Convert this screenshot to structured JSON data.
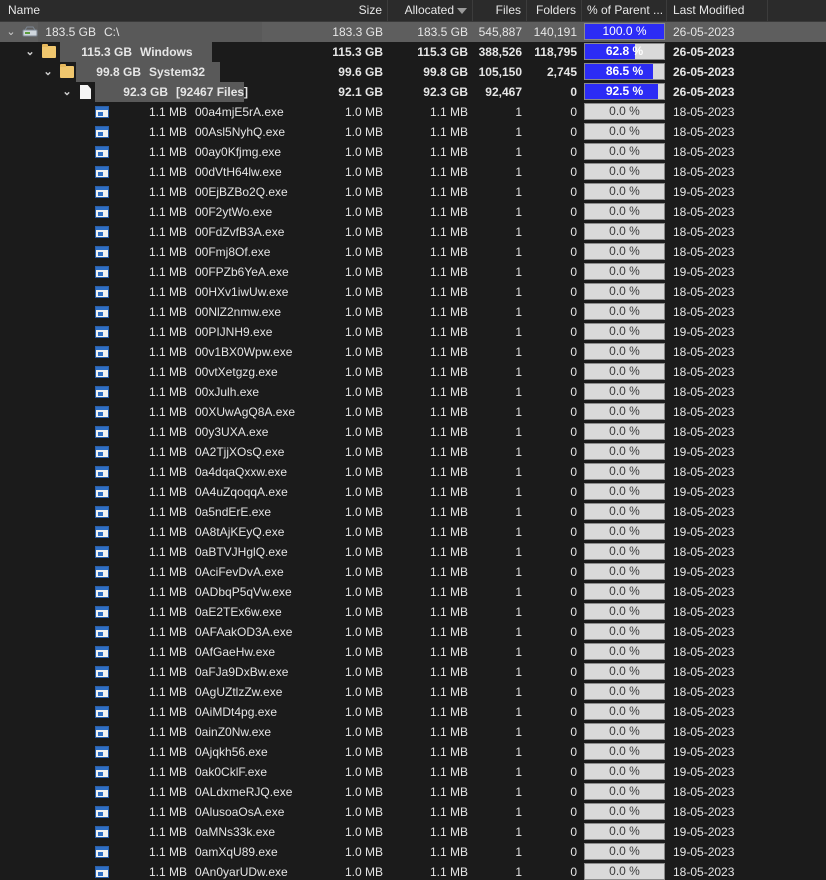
{
  "columns": {
    "name": "Name",
    "size": "Size",
    "allocated": "Allocated",
    "files": "Files",
    "folders": "Folders",
    "pct_parent": "% of Parent ...",
    "last_modified": "Last Modified"
  },
  "colors": {
    "background": "#1b1b1b",
    "header": "#2b2b2b",
    "selected_row": "#5e5e5e",
    "bar_fill": "#2c2cf5",
    "bar_track": "#d9d9d9",
    "folder": "#f0c76e",
    "exe_icon": "#2f6fc4"
  },
  "tree": [
    {
      "level": 0,
      "icon": "drive-icon",
      "expanded": true,
      "selected": true,
      "bold": false,
      "label_size": "183.5 GB",
      "label_name": "C:\\",
      "size": "183.3 GB",
      "allocated": "183.5 GB",
      "files": "545,887",
      "folders": "140,191",
      "pct": "100.0 %",
      "pct_value": 100.0,
      "modified": "26-05-2023"
    },
    {
      "level": 1,
      "icon": "folder-icon",
      "expanded": true,
      "selected": false,
      "bold": true,
      "label_size": "115.3 GB",
      "label_name": "Windows",
      "size": "115.3 GB",
      "allocated": "115.3 GB",
      "files": "388,526",
      "folders": "118,795",
      "pct": "62.8 %",
      "pct_value": 62.8,
      "modified": "26-05-2023"
    },
    {
      "level": 2,
      "icon": "folder-icon",
      "expanded": true,
      "selected": false,
      "bold": true,
      "label_size": "99.8 GB",
      "label_name": "System32",
      "size": "99.6 GB",
      "allocated": "99.8 GB",
      "files": "105,150",
      "folders": "2,745",
      "pct": "86.5 %",
      "pct_value": 86.5,
      "modified": "26-05-2023"
    },
    {
      "level": 3,
      "icon": "file-icon",
      "expanded": true,
      "selected": false,
      "bold": true,
      "label_size": "92.3 GB",
      "label_name": "[92467 Files]",
      "size": "92.1 GB",
      "allocated": "92.3 GB",
      "files": "92,467",
      "folders": "0",
      "pct": "92.5 %",
      "pct_value": 92.5,
      "modified": "26-05-2023"
    }
  ],
  "files": [
    {
      "label_size": "1.1 MB",
      "name": "00a4mjE5rA.exe",
      "size": "1.0 MB",
      "allocated": "1.1 MB",
      "files": "1",
      "folders": "0",
      "pct": "0.0 %",
      "pct_value": 0.0,
      "modified": "18-05-2023"
    },
    {
      "label_size": "1.1 MB",
      "name": "00Asl5NyhQ.exe",
      "size": "1.0 MB",
      "allocated": "1.1 MB",
      "files": "1",
      "folders": "0",
      "pct": "0.0 %",
      "pct_value": 0.0,
      "modified": "18-05-2023"
    },
    {
      "label_size": "1.1 MB",
      "name": "00ay0Kfjmg.exe",
      "size": "1.0 MB",
      "allocated": "1.1 MB",
      "files": "1",
      "folders": "0",
      "pct": "0.0 %",
      "pct_value": 0.0,
      "modified": "18-05-2023"
    },
    {
      "label_size": "1.1 MB",
      "name": "00dVtH64lw.exe",
      "size": "1.0 MB",
      "allocated": "1.1 MB",
      "files": "1",
      "folders": "0",
      "pct": "0.0 %",
      "pct_value": 0.0,
      "modified": "18-05-2023"
    },
    {
      "label_size": "1.1 MB",
      "name": "00EjBZBo2Q.exe",
      "size": "1.0 MB",
      "allocated": "1.1 MB",
      "files": "1",
      "folders": "0",
      "pct": "0.0 %",
      "pct_value": 0.0,
      "modified": "19-05-2023"
    },
    {
      "label_size": "1.1 MB",
      "name": "00F2ytWo.exe",
      "size": "1.0 MB",
      "allocated": "1.1 MB",
      "files": "1",
      "folders": "0",
      "pct": "0.0 %",
      "pct_value": 0.0,
      "modified": "18-05-2023"
    },
    {
      "label_size": "1.1 MB",
      "name": "00FdZvfB3A.exe",
      "size": "1.0 MB",
      "allocated": "1.1 MB",
      "files": "1",
      "folders": "0",
      "pct": "0.0 %",
      "pct_value": 0.0,
      "modified": "18-05-2023"
    },
    {
      "label_size": "1.1 MB",
      "name": "00Fmj8Of.exe",
      "size": "1.0 MB",
      "allocated": "1.1 MB",
      "files": "1",
      "folders": "0",
      "pct": "0.0 %",
      "pct_value": 0.0,
      "modified": "18-05-2023"
    },
    {
      "label_size": "1.1 MB",
      "name": "00FPZb6YeA.exe",
      "size": "1.0 MB",
      "allocated": "1.1 MB",
      "files": "1",
      "folders": "0",
      "pct": "0.0 %",
      "pct_value": 0.0,
      "modified": "19-05-2023"
    },
    {
      "label_size": "1.1 MB",
      "name": "00HXv1iwUw.exe",
      "size": "1.0 MB",
      "allocated": "1.1 MB",
      "files": "1",
      "folders": "0",
      "pct": "0.0 %",
      "pct_value": 0.0,
      "modified": "18-05-2023"
    },
    {
      "label_size": "1.1 MB",
      "name": "00NlZ2nmw.exe",
      "size": "1.0 MB",
      "allocated": "1.1 MB",
      "files": "1",
      "folders": "0",
      "pct": "0.0 %",
      "pct_value": 0.0,
      "modified": "18-05-2023"
    },
    {
      "label_size": "1.1 MB",
      "name": "00PIJNH9.exe",
      "size": "1.0 MB",
      "allocated": "1.1 MB",
      "files": "1",
      "folders": "0",
      "pct": "0.0 %",
      "pct_value": 0.0,
      "modified": "19-05-2023"
    },
    {
      "label_size": "1.1 MB",
      "name": "00v1BX0Wpw.exe",
      "size": "1.0 MB",
      "allocated": "1.1 MB",
      "files": "1",
      "folders": "0",
      "pct": "0.0 %",
      "pct_value": 0.0,
      "modified": "18-05-2023"
    },
    {
      "label_size": "1.1 MB",
      "name": "00vtXetgzg.exe",
      "size": "1.0 MB",
      "allocated": "1.1 MB",
      "files": "1",
      "folders": "0",
      "pct": "0.0 %",
      "pct_value": 0.0,
      "modified": "18-05-2023"
    },
    {
      "label_size": "1.1 MB",
      "name": "00xJulh.exe",
      "size": "1.0 MB",
      "allocated": "1.1 MB",
      "files": "1",
      "folders": "0",
      "pct": "0.0 %",
      "pct_value": 0.0,
      "modified": "18-05-2023"
    },
    {
      "label_size": "1.1 MB",
      "name": "00XUwAgQ8A.exe",
      "size": "1.0 MB",
      "allocated": "1.1 MB",
      "files": "1",
      "folders": "0",
      "pct": "0.0 %",
      "pct_value": 0.0,
      "modified": "18-05-2023"
    },
    {
      "label_size": "1.1 MB",
      "name": "00y3UXA.exe",
      "size": "1.0 MB",
      "allocated": "1.1 MB",
      "files": "1",
      "folders": "0",
      "pct": "0.0 %",
      "pct_value": 0.0,
      "modified": "18-05-2023"
    },
    {
      "label_size": "1.1 MB",
      "name": "0A2TjjXOsQ.exe",
      "size": "1.0 MB",
      "allocated": "1.1 MB",
      "files": "1",
      "folders": "0",
      "pct": "0.0 %",
      "pct_value": 0.0,
      "modified": "19-05-2023"
    },
    {
      "label_size": "1.1 MB",
      "name": "0a4dqaQxxw.exe",
      "size": "1.0 MB",
      "allocated": "1.1 MB",
      "files": "1",
      "folders": "0",
      "pct": "0.0 %",
      "pct_value": 0.0,
      "modified": "18-05-2023"
    },
    {
      "label_size": "1.1 MB",
      "name": "0A4uZqoqqA.exe",
      "size": "1.0 MB",
      "allocated": "1.1 MB",
      "files": "1",
      "folders": "0",
      "pct": "0.0 %",
      "pct_value": 0.0,
      "modified": "19-05-2023"
    },
    {
      "label_size": "1.1 MB",
      "name": "0a5ndErE.exe",
      "size": "1.0 MB",
      "allocated": "1.1 MB",
      "files": "1",
      "folders": "0",
      "pct": "0.0 %",
      "pct_value": 0.0,
      "modified": "18-05-2023"
    },
    {
      "label_size": "1.1 MB",
      "name": "0A8tAjKEyQ.exe",
      "size": "1.0 MB",
      "allocated": "1.1 MB",
      "files": "1",
      "folders": "0",
      "pct": "0.0 %",
      "pct_value": 0.0,
      "modified": "19-05-2023"
    },
    {
      "label_size": "1.1 MB",
      "name": "0aBTVJHglQ.exe",
      "size": "1.0 MB",
      "allocated": "1.1 MB",
      "files": "1",
      "folders": "0",
      "pct": "0.0 %",
      "pct_value": 0.0,
      "modified": "18-05-2023"
    },
    {
      "label_size": "1.1 MB",
      "name": "0AciFevDvA.exe",
      "size": "1.0 MB",
      "allocated": "1.1 MB",
      "files": "1",
      "folders": "0",
      "pct": "0.0 %",
      "pct_value": 0.0,
      "modified": "19-05-2023"
    },
    {
      "label_size": "1.1 MB",
      "name": "0ADbqP5qVw.exe",
      "size": "1.0 MB",
      "allocated": "1.1 MB",
      "files": "1",
      "folders": "0",
      "pct": "0.0 %",
      "pct_value": 0.0,
      "modified": "18-05-2023"
    },
    {
      "label_size": "1.1 MB",
      "name": "0aE2TEx6w.exe",
      "size": "1.0 MB",
      "allocated": "1.1 MB",
      "files": "1",
      "folders": "0",
      "pct": "0.0 %",
      "pct_value": 0.0,
      "modified": "18-05-2023"
    },
    {
      "label_size": "1.1 MB",
      "name": "0AFAakOD3A.exe",
      "size": "1.0 MB",
      "allocated": "1.1 MB",
      "files": "1",
      "folders": "0",
      "pct": "0.0 %",
      "pct_value": 0.0,
      "modified": "18-05-2023"
    },
    {
      "label_size": "1.1 MB",
      "name": "0AfGaeHw.exe",
      "size": "1.0 MB",
      "allocated": "1.1 MB",
      "files": "1",
      "folders": "0",
      "pct": "0.0 %",
      "pct_value": 0.0,
      "modified": "18-05-2023"
    },
    {
      "label_size": "1.1 MB",
      "name": "0aFJa9DxBw.exe",
      "size": "1.0 MB",
      "allocated": "1.1 MB",
      "files": "1",
      "folders": "0",
      "pct": "0.0 %",
      "pct_value": 0.0,
      "modified": "18-05-2023"
    },
    {
      "label_size": "1.1 MB",
      "name": "0AgUZtlzZw.exe",
      "size": "1.0 MB",
      "allocated": "1.1 MB",
      "files": "1",
      "folders": "0",
      "pct": "0.0 %",
      "pct_value": 0.0,
      "modified": "18-05-2023"
    },
    {
      "label_size": "1.1 MB",
      "name": "0AiMDt4pg.exe",
      "size": "1.0 MB",
      "allocated": "1.1 MB",
      "files": "1",
      "folders": "0",
      "pct": "0.0 %",
      "pct_value": 0.0,
      "modified": "18-05-2023"
    },
    {
      "label_size": "1.1 MB",
      "name": "0ainZ0Nw.exe",
      "size": "1.0 MB",
      "allocated": "1.1 MB",
      "files": "1",
      "folders": "0",
      "pct": "0.0 %",
      "pct_value": 0.0,
      "modified": "18-05-2023"
    },
    {
      "label_size": "1.1 MB",
      "name": "0Ajqkh56.exe",
      "size": "1.0 MB",
      "allocated": "1.1 MB",
      "files": "1",
      "folders": "0",
      "pct": "0.0 %",
      "pct_value": 0.0,
      "modified": "19-05-2023"
    },
    {
      "label_size": "1.1 MB",
      "name": "0ak0CklF.exe",
      "size": "1.0 MB",
      "allocated": "1.1 MB",
      "files": "1",
      "folders": "0",
      "pct": "0.0 %",
      "pct_value": 0.0,
      "modified": "19-05-2023"
    },
    {
      "label_size": "1.1 MB",
      "name": "0ALdxmeRJQ.exe",
      "size": "1.0 MB",
      "allocated": "1.1 MB",
      "files": "1",
      "folders": "0",
      "pct": "0.0 %",
      "pct_value": 0.0,
      "modified": "18-05-2023"
    },
    {
      "label_size": "1.1 MB",
      "name": "0AlusoaOsA.exe",
      "size": "1.0 MB",
      "allocated": "1.1 MB",
      "files": "1",
      "folders": "0",
      "pct": "0.0 %",
      "pct_value": 0.0,
      "modified": "18-05-2023"
    },
    {
      "label_size": "1.1 MB",
      "name": "0aMNs33k.exe",
      "size": "1.0 MB",
      "allocated": "1.1 MB",
      "files": "1",
      "folders": "0",
      "pct": "0.0 %",
      "pct_value": 0.0,
      "modified": "19-05-2023"
    },
    {
      "label_size": "1.1 MB",
      "name": "0amXqU89.exe",
      "size": "1.0 MB",
      "allocated": "1.1 MB",
      "files": "1",
      "folders": "0",
      "pct": "0.0 %",
      "pct_value": 0.0,
      "modified": "19-05-2023"
    },
    {
      "label_size": "1.1 MB",
      "name": "0An0yarUDw.exe",
      "size": "1.0 MB",
      "allocated": "1.1 MB",
      "files": "1",
      "folders": "0",
      "pct": "0.0 %",
      "pct_value": 0.0,
      "modified": "18-05-2023"
    }
  ]
}
